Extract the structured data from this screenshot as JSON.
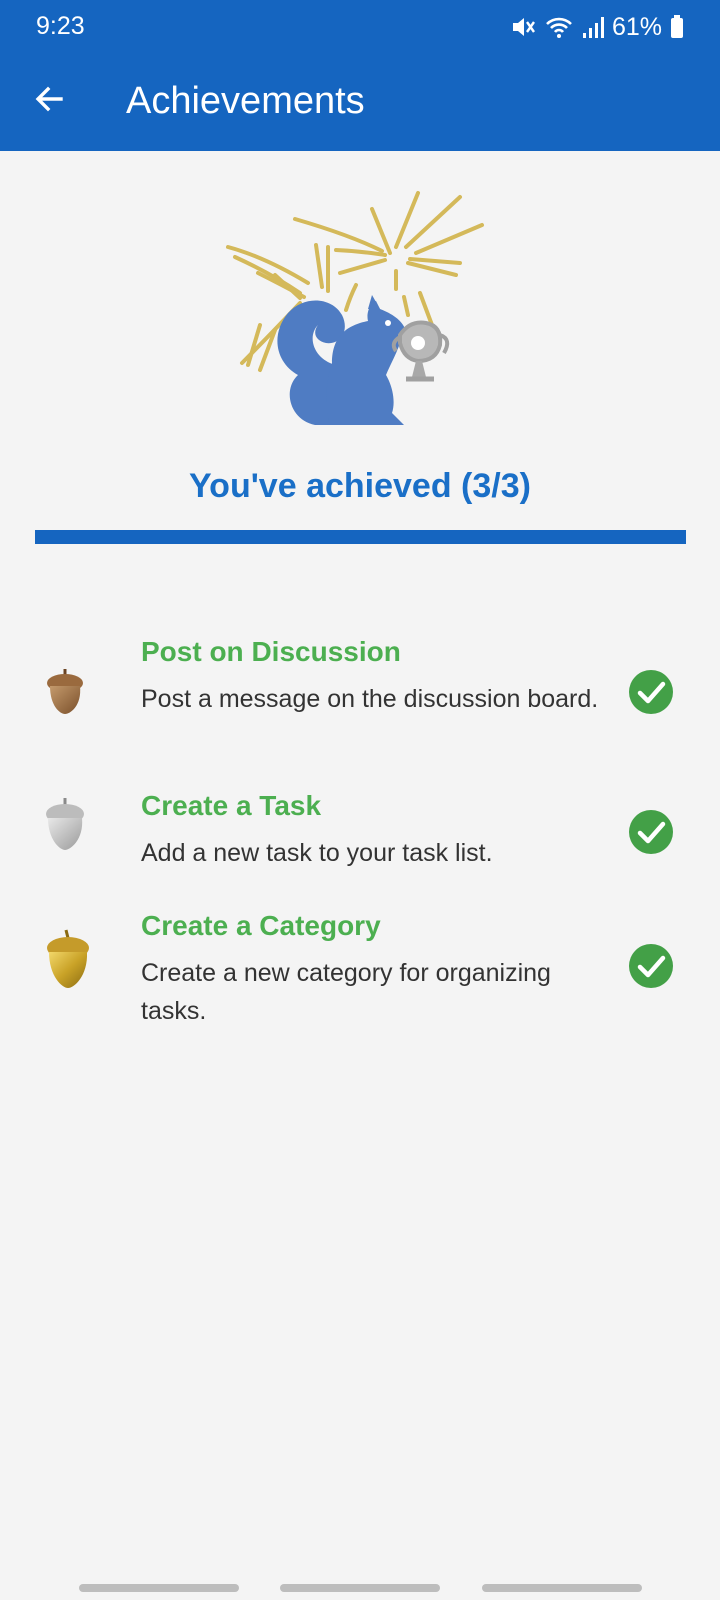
{
  "status": {
    "time": "9:23",
    "battery": "61%"
  },
  "header": {
    "title": "Achievements",
    "back_icon": "arrow-left-icon"
  },
  "summary": {
    "text": "You've achieved (3/3)",
    "progress_fraction": 1.0
  },
  "achievements": [
    {
      "title": "Post on Discussion",
      "description": "Post a message on the discussion board.",
      "acorn": "bronze",
      "completed": true
    },
    {
      "title": "Create a Task",
      "description": "Add a new task to your task list.",
      "acorn": "silver",
      "completed": true
    },
    {
      "title": "Create a Category",
      "description": "Create a new category for organizing tasks.",
      "acorn": "gold",
      "completed": true
    }
  ],
  "colors": {
    "appbar": "#1565c0",
    "accent_green": "#4caf50",
    "summary_blue": "#1a6fc7",
    "squirrel": "#4f7cc3",
    "fireworks": "#d4b95a"
  }
}
